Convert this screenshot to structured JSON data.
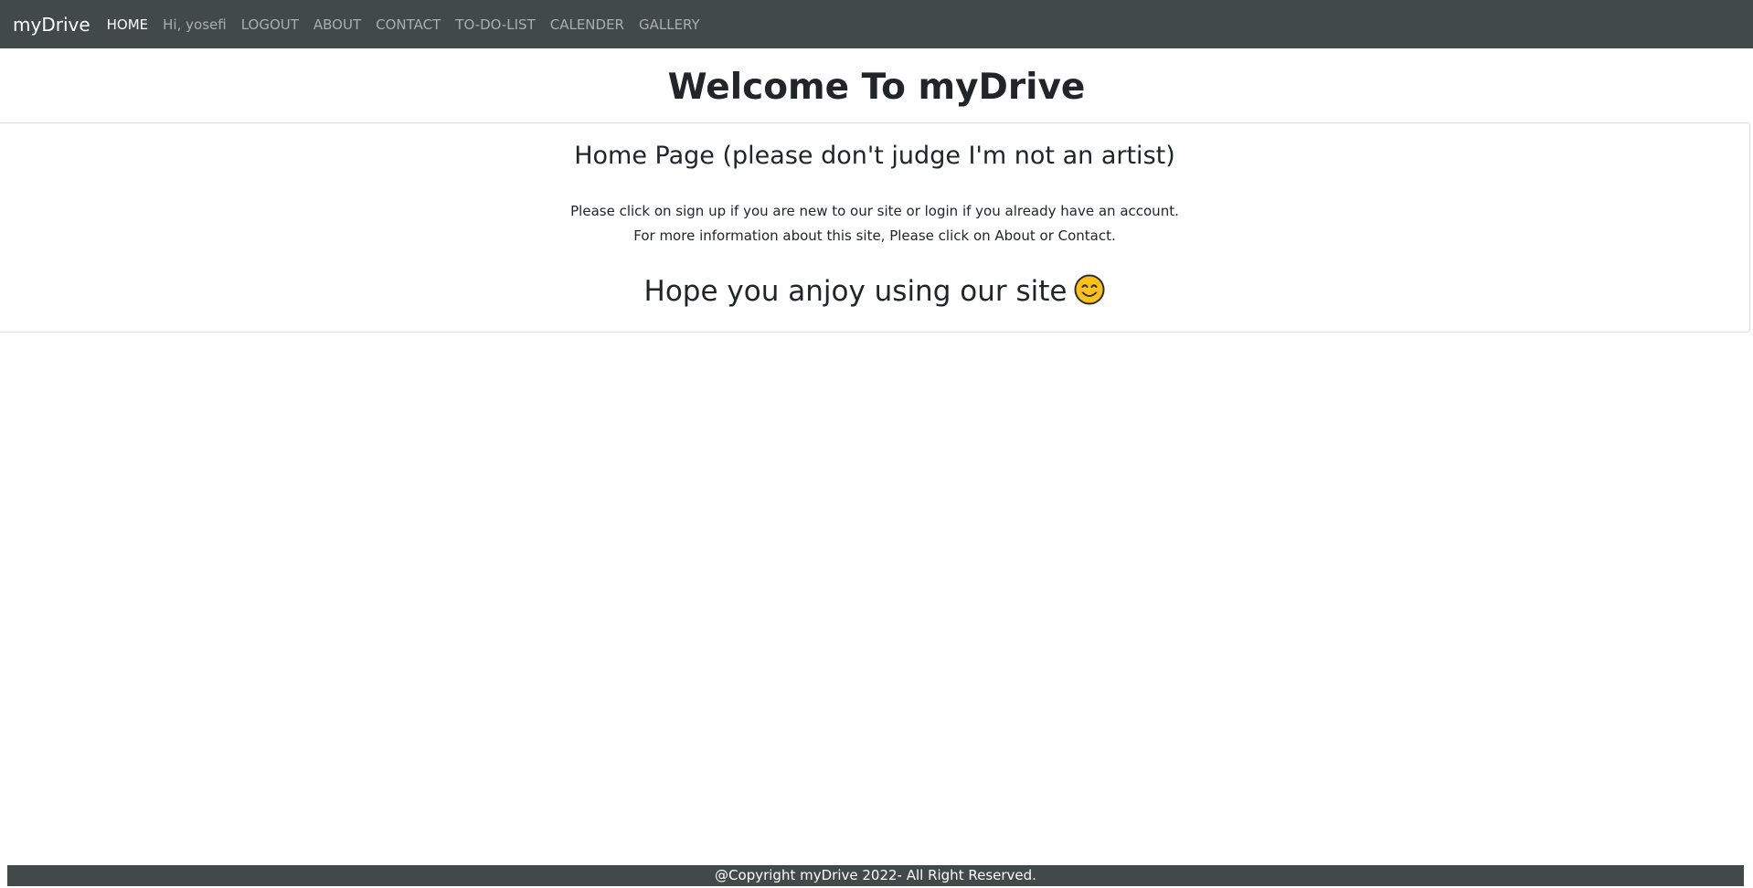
{
  "navbar": {
    "brand": "myDrive",
    "links": [
      {
        "label": "HOME",
        "active": true
      },
      {
        "label": "Hi, yosefi",
        "active": false
      },
      {
        "label": "LOGOUT",
        "active": false
      },
      {
        "label": "ABOUT",
        "active": false
      },
      {
        "label": "CONTACT",
        "active": false
      },
      {
        "label": "TO-DO-LIST",
        "active": false
      },
      {
        "label": "CALENDER",
        "active": false
      },
      {
        "label": "GALLERY",
        "active": false
      }
    ]
  },
  "main": {
    "title": "Welcome To myDrive",
    "card": {
      "heading": "Home Page (please don't judge I'm not an artist)",
      "line1": "Please click on sign up if you are new to our site or login if you already have an account.",
      "line2": "For more information about this site, Please click on About or Contact.",
      "closing": "Hope you anjoy using our site",
      "closing_icon": "smiling-face-icon"
    }
  },
  "footer": {
    "text": "@Copyright myDrive 2022- All Right Reserved."
  },
  "colors": {
    "navbar_bg": "#424949",
    "footer_bg": "#424949",
    "text": "#212529"
  }
}
